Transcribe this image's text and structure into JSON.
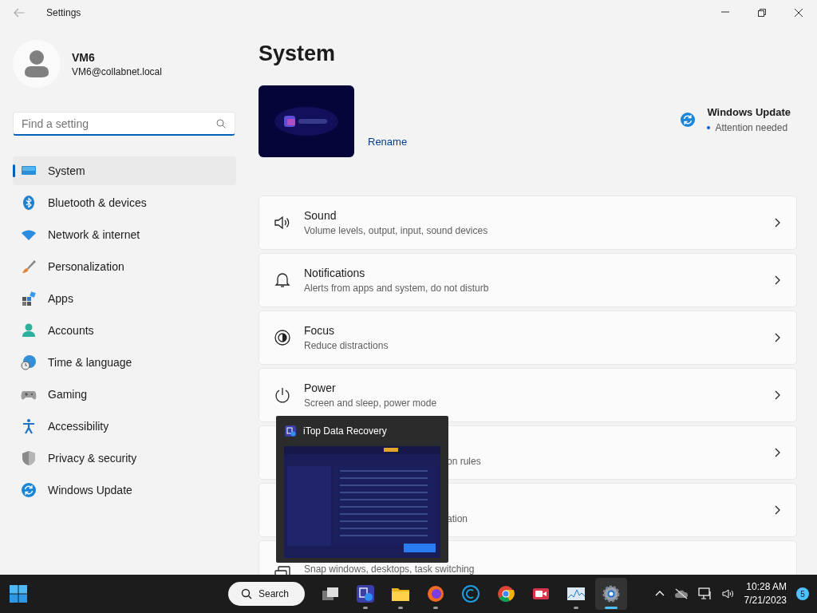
{
  "window": {
    "title": "Settings"
  },
  "user": {
    "name": "VM6",
    "email": "VM6@collabnet.local"
  },
  "search": {
    "placeholder": "Find a setting"
  },
  "sidebar": {
    "items": [
      {
        "label": "System",
        "selected": true
      },
      {
        "label": "Bluetooth & devices",
        "selected": false
      },
      {
        "label": "Network & internet",
        "selected": false
      },
      {
        "label": "Personalization",
        "selected": false
      },
      {
        "label": "Apps",
        "selected": false
      },
      {
        "label": "Accounts",
        "selected": false
      },
      {
        "label": "Time & language",
        "selected": false
      },
      {
        "label": "Gaming",
        "selected": false
      },
      {
        "label": "Accessibility",
        "selected": false
      },
      {
        "label": "Privacy & security",
        "selected": false
      },
      {
        "label": "Windows Update",
        "selected": false
      }
    ]
  },
  "page": {
    "title": "System",
    "rename": "Rename",
    "update": {
      "title": "Windows Update",
      "status": "Attention needed"
    }
  },
  "settings": [
    {
      "kind": "full",
      "title": "Sound",
      "subtitle": "Volume levels, output, input, sound devices"
    },
    {
      "kind": "full",
      "title": "Notifications",
      "subtitle": "Alerts from apps and system, do not disturb"
    },
    {
      "kind": "full",
      "title": "Focus",
      "subtitle": "Reduce distractions"
    },
    {
      "kind": "full",
      "title": "Power",
      "subtitle": "Screen and sleep, power mode"
    },
    {
      "kind": "covered",
      "subtitle": "on rules"
    },
    {
      "kind": "covered",
      "subtitle": "ation"
    },
    {
      "kind": "bottom",
      "subtitle": "Snap windows, desktops, task switching"
    }
  ],
  "preview": {
    "title": "iTop Data Recovery"
  },
  "taskbar": {
    "search": "Search",
    "apps": [
      {
        "running": false,
        "selected": false
      },
      {
        "running": true,
        "selected": false
      },
      {
        "running": true,
        "selected": false
      },
      {
        "running": true,
        "selected": false
      },
      {
        "running": false,
        "selected": false
      },
      {
        "running": false,
        "selected": false
      },
      {
        "running": false,
        "selected": false
      },
      {
        "running": true,
        "selected": false
      },
      {
        "running": true,
        "selected": true
      }
    ],
    "time": "10:28 AM",
    "date": "7/21/2023",
    "badge": "5"
  }
}
